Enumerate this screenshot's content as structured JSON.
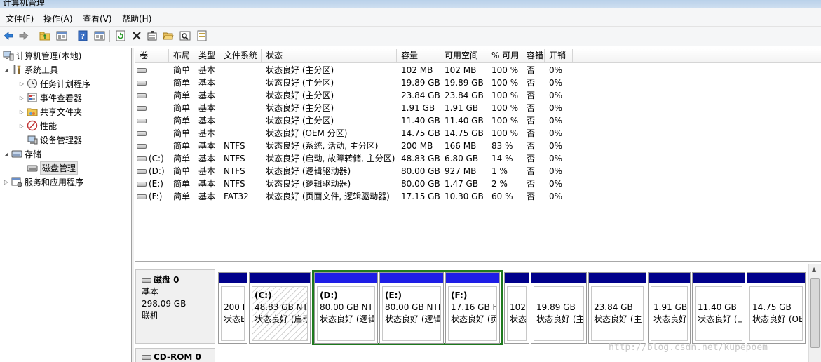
{
  "window": {
    "title": "计算机管理"
  },
  "menu": [
    "文件(F)",
    "操作(A)",
    "查看(V)",
    "帮助(H)"
  ],
  "toolbar": {
    "buttons": [
      "back-icon",
      "forward-icon",
      "up-folder-icon",
      "show-hide-tree-icon",
      "help-icon",
      "properties-pane-icon",
      "refresh-icon",
      "delete-icon",
      "properties-icon",
      "open-icon",
      "search-icon",
      "settings-icon"
    ]
  },
  "tree": {
    "root": "计算机管理(本地)",
    "system_tools": "系统工具",
    "task_scheduler": "任务计划程序",
    "event_viewer": "事件查看器",
    "shared_folders": "共享文件夹",
    "performance": "性能",
    "device_manager": "设备管理器",
    "storage": "存储",
    "disk_management": "磁盘管理",
    "services_apps": "服务和应用程序"
  },
  "volume_table": {
    "headers": [
      "卷",
      "布局",
      "类型",
      "文件系统",
      "状态",
      "容量",
      "可用空间",
      "% 可用",
      "容错",
      "开销"
    ],
    "rows": [
      [
        "",
        "简单",
        "基本",
        "",
        "状态良好 (主分区)",
        "102 MB",
        "102 MB",
        "100 %",
        "否",
        "0%"
      ],
      [
        "",
        "简单",
        "基本",
        "",
        "状态良好 (主分区)",
        "19.89 GB",
        "19.89 GB",
        "100 %",
        "否",
        "0%"
      ],
      [
        "",
        "简单",
        "基本",
        "",
        "状态良好 (主分区)",
        "23.84 GB",
        "23.84 GB",
        "100 %",
        "否",
        "0%"
      ],
      [
        "",
        "简单",
        "基本",
        "",
        "状态良好 (主分区)",
        "1.91 GB",
        "1.91 GB",
        "100 %",
        "否",
        "0%"
      ],
      [
        "",
        "简单",
        "基本",
        "",
        "状态良好 (主分区)",
        "11.40 GB",
        "11.40 GB",
        "100 %",
        "否",
        "0%"
      ],
      [
        "",
        "简单",
        "基本",
        "",
        "状态良好 (OEM 分区)",
        "14.75 GB",
        "14.75 GB",
        "100 %",
        "否",
        "0%"
      ],
      [
        "",
        "简单",
        "基本",
        "NTFS",
        "状态良好 (系统, 活动, 主分区)",
        "200 MB",
        "166 MB",
        "83 %",
        "否",
        "0%"
      ],
      [
        "(C:)",
        "简单",
        "基本",
        "NTFS",
        "状态良好 (启动, 故障转储, 主分区)",
        "48.83 GB",
        "6.80 GB",
        "14 %",
        "否",
        "0%"
      ],
      [
        "(D:)",
        "简单",
        "基本",
        "NTFS",
        "状态良好 (逻辑驱动器)",
        "80.00 GB",
        "927 MB",
        "1 %",
        "否",
        "0%"
      ],
      [
        "(E:)",
        "简单",
        "基本",
        "NTFS",
        "状态良好 (逻辑驱动器)",
        "80.00 GB",
        "1.47 GB",
        "2 %",
        "否",
        "0%"
      ],
      [
        "(F:)",
        "简单",
        "基本",
        "FAT32",
        "状态良好 (页面文件, 逻辑驱动器)",
        "17.15 GB",
        "10.30 GB",
        "60 %",
        "否",
        "0%"
      ]
    ]
  },
  "disk0": {
    "name": "磁盘 0",
    "type": "基本",
    "size": "298.09 GB",
    "status": "联机",
    "partitions": [
      {
        "name": "",
        "size": "200 I",
        "status": "状态E",
        "kind": "primary"
      },
      {
        "name": "(C:)",
        "size": "48.83 GB NTI",
        "status": "状态良好 (启动",
        "kind": "primary-hatched"
      },
      {
        "name": "(D:)",
        "size": "80.00 GB NTI",
        "status": "状态良好 (逻辑",
        "kind": "logical"
      },
      {
        "name": "(E:)",
        "size": "80.00 GB NTF",
        "status": "状态良好 (逻辑",
        "kind": "logical"
      },
      {
        "name": "(F:)",
        "size": "17.16 GB F",
        "status": "状态良好 (页",
        "kind": "logical"
      },
      {
        "name": "",
        "size": "102",
        "status": "状态",
        "kind": "primary"
      },
      {
        "name": "",
        "size": "19.89 GB",
        "status": "状态良好 (主",
        "kind": "primary"
      },
      {
        "name": "",
        "size": "23.84 GB",
        "status": "状态良好 (主",
        "kind": "primary"
      },
      {
        "name": "",
        "size": "1.91 GB",
        "status": "状态良好",
        "kind": "primary"
      },
      {
        "name": "",
        "size": "11.40 GB",
        "status": "状态良好 (三",
        "kind": "primary"
      },
      {
        "name": "",
        "size": "14.75 GB",
        "status": "状态良好 (OE",
        "kind": "primary"
      }
    ]
  },
  "cdrom0": {
    "name": "CD-ROM 0"
  },
  "watermark": "http://blog.csdn.net/kupepoem"
}
